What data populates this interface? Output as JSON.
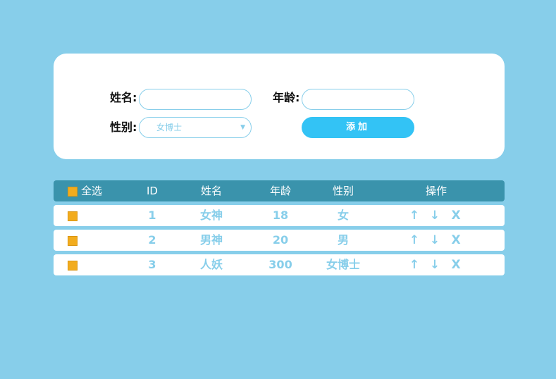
{
  "form": {
    "name_label": "姓名:",
    "age_label": "年龄:",
    "sex_label": "性别:",
    "name_value": "",
    "age_value": "",
    "sex_selected": "女博士",
    "add_button": "添加"
  },
  "table": {
    "headers": {
      "select_all": "全选",
      "id": "ID",
      "name": "姓名",
      "age": "年龄",
      "sex": "性别",
      "ops": "操作"
    },
    "rows": [
      {
        "id": "1",
        "name": "女神",
        "age": "18",
        "sex": "女"
      },
      {
        "id": "2",
        "name": "男神",
        "age": "20",
        "sex": "男"
      },
      {
        "id": "3",
        "name": "人妖",
        "age": "300",
        "sex": "女博士"
      }
    ],
    "op_labels": {
      "up": "↑",
      "down": "↓",
      "delete": "X"
    }
  },
  "colors": {
    "background": "#87ceea",
    "header_bg": "#3a93ac",
    "button_bg": "#33c3f5",
    "checkbox": "#f2ac1e"
  },
  "icons": {
    "select_arrow": "chevron-down-icon"
  }
}
